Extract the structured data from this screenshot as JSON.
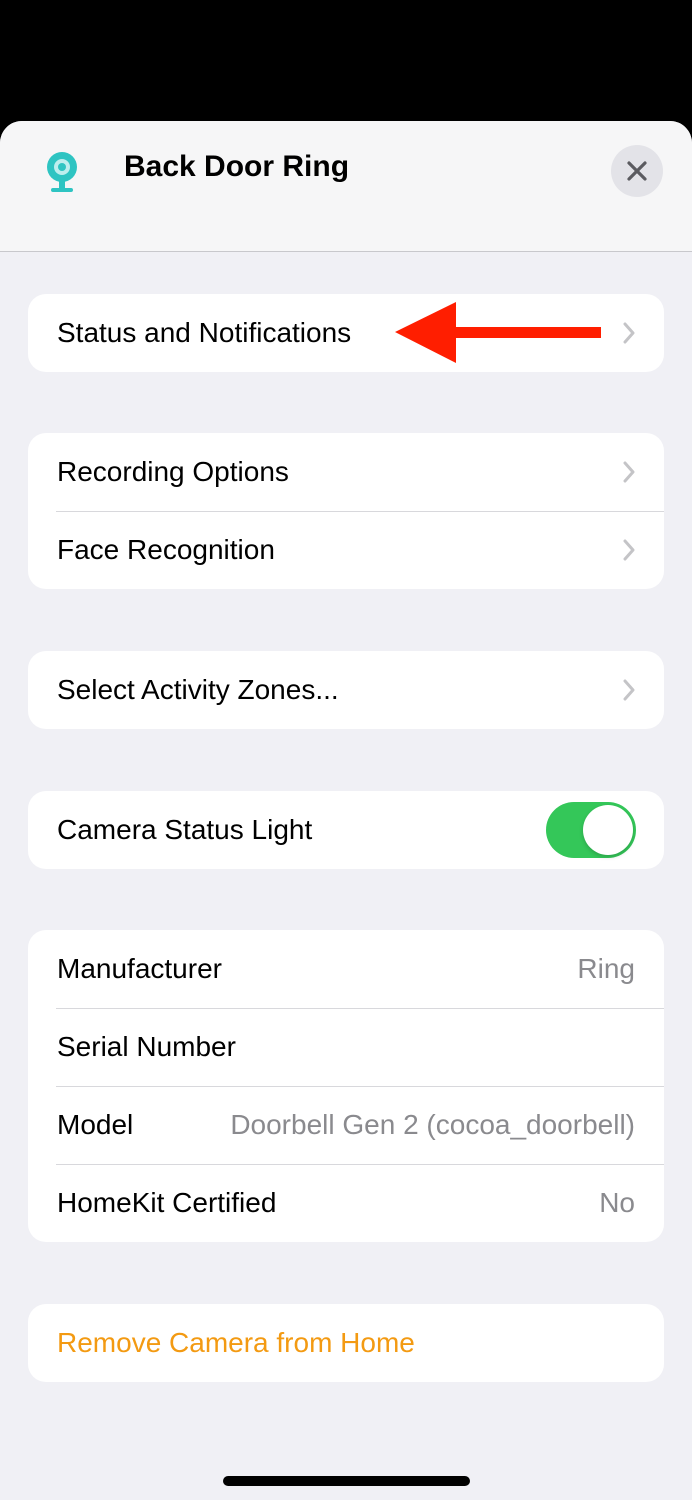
{
  "header": {
    "title": "Back Door Ring",
    "icon": "camera-icon",
    "close_icon": "close-icon",
    "accent_color": "#2ec4c2"
  },
  "groups": {
    "status": {
      "label": "Status and Notifications"
    },
    "recording": {
      "items": [
        {
          "label": "Recording Options"
        },
        {
          "label": "Face Recognition"
        }
      ]
    },
    "zones": {
      "label": "Select Activity Zones..."
    },
    "status_light": {
      "label": "Camera Status Light",
      "enabled": true,
      "toggle_color": "#34c759"
    },
    "info": {
      "items": [
        {
          "label": "Manufacturer",
          "value": "Ring"
        },
        {
          "label": "Serial Number",
          "value": ""
        },
        {
          "label": "Model",
          "value": "Doorbell Gen 2 (cocoa_doorbell)"
        },
        {
          "label": "HomeKit Certified",
          "value": "No"
        }
      ]
    },
    "remove": {
      "label": "Remove Camera from Home",
      "color": "#f39a12"
    }
  },
  "annotation": {
    "icon": "red-arrow-icon",
    "color": "#ff1e00"
  }
}
